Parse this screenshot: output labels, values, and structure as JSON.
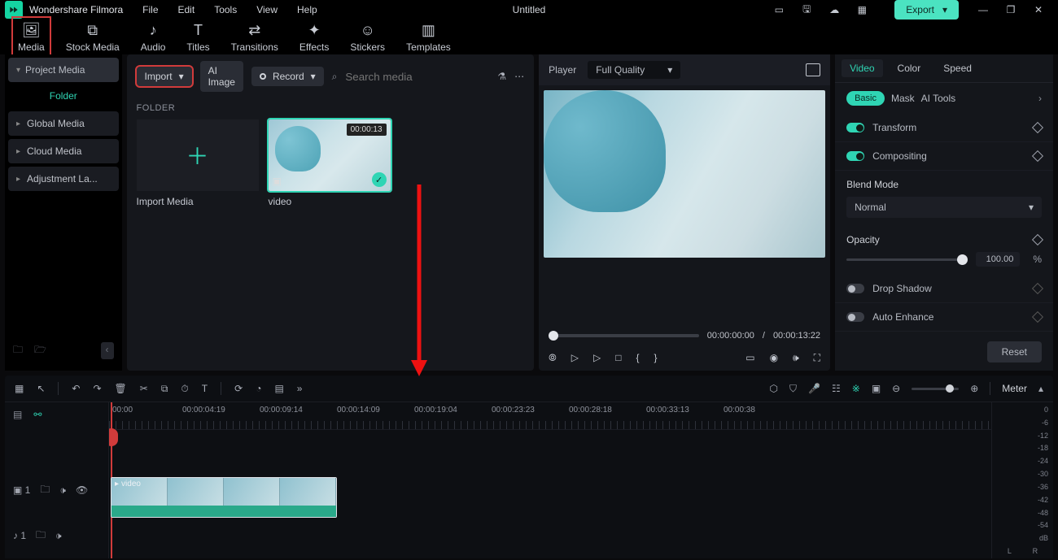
{
  "app": {
    "brand": "Wondershare Filmora",
    "doc": "Untitled",
    "export": "Export"
  },
  "menu": [
    "File",
    "Edit",
    "Tools",
    "View",
    "Help"
  ],
  "tooltabs": [
    {
      "id": "media",
      "label": "Media",
      "sel": true
    },
    {
      "id": "stock",
      "label": "Stock Media"
    },
    {
      "id": "audio",
      "label": "Audio"
    },
    {
      "id": "titles",
      "label": "Titles"
    },
    {
      "id": "trans",
      "label": "Transitions"
    },
    {
      "id": "effects",
      "label": "Effects"
    },
    {
      "id": "stickers",
      "label": "Stickers"
    },
    {
      "id": "templates",
      "label": "Templates"
    }
  ],
  "nav": {
    "project": "Project Media",
    "folder": "Folder",
    "items": [
      "Global Media",
      "Cloud Media",
      "Adjustment La..."
    ]
  },
  "mediabar": {
    "import": "Import",
    "ai": "AI Image",
    "record": "Record",
    "search_ph": "Search media"
  },
  "mediapane": {
    "folder_hdr": "FOLDER",
    "import_cap": "Import Media",
    "clip": {
      "name": "video",
      "dur": "00:00:13"
    }
  },
  "player": {
    "label": "Player",
    "quality": "Full Quality",
    "cur": "00:00:00:00",
    "sep": "/",
    "total": "00:00:13:22"
  },
  "inspector": {
    "tabs": [
      "Video",
      "Color",
      "Speed"
    ],
    "sub": [
      "Basic",
      "Mask",
      "AI Tools"
    ],
    "transform": "Transform",
    "compositing": "Compositing",
    "blend_lbl": "Blend Mode",
    "blend_val": "Normal",
    "opacity_lbl": "Opacity",
    "opacity_val": "100.00",
    "pct": "%",
    "drop": "Drop Shadow",
    "auto": "Auto Enhance",
    "reset": "Reset"
  },
  "timeline": {
    "meter": "Meter",
    "ticks": [
      "00:00",
      "00:00:04:19",
      "00:00:09:14",
      "00:00:14:09",
      "00:00:19:04",
      "00:00:23:23",
      "00:00:28:18",
      "00:00:33:13",
      "00:00:38"
    ],
    "meter_vals": [
      "0",
      "-6",
      "-12",
      "-18",
      "-24",
      "-30",
      "-36",
      "-42",
      "-48",
      "-54",
      "dB"
    ],
    "lr": [
      "L",
      "R"
    ],
    "clip": "video"
  }
}
